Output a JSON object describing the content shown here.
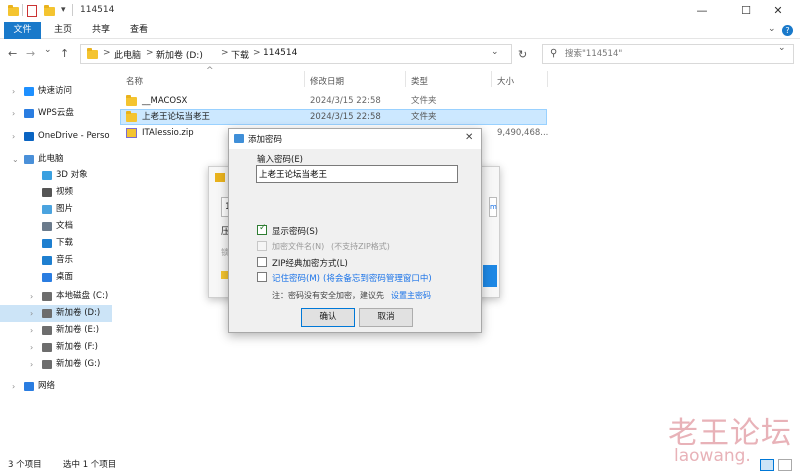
{
  "window": {
    "title": "114514",
    "minimize": "—",
    "maximize": "☐",
    "close": "✕"
  },
  "ribbon": {
    "tabs": [
      "文件",
      "主页",
      "共享",
      "查看"
    ],
    "collapse_icon": "chevron-down-icon",
    "help_icon": "help-icon"
  },
  "address": {
    "back": "←",
    "forward": "→",
    "recent": "⌄",
    "up": "↑",
    "crumbs": [
      "此电脑",
      "新加卷 (D:)",
      "下载",
      "114514"
    ],
    "separator": ">",
    "refresh": "↻",
    "search_placeholder": "搜索\"114514\""
  },
  "sidebar": {
    "items": [
      {
        "label": "快速访问",
        "icon": "star-icon",
        "color": "#1e90ff"
      },
      {
        "label": "WPS云盘",
        "icon": "cloud-icon",
        "color": "#2a7de1"
      },
      {
        "label": "OneDrive - Perso",
        "icon": "onedrive-icon",
        "color": "#0a64c2"
      },
      {
        "label": "此电脑",
        "icon": "computer-icon",
        "color": "#4a90d9"
      },
      {
        "label": "3D 对象",
        "icon": "cube-icon",
        "color": "#3aa0e0"
      },
      {
        "label": "视频",
        "icon": "video-icon",
        "color": "#555555"
      },
      {
        "label": "图片",
        "icon": "picture-icon",
        "color": "#4aa3df"
      },
      {
        "label": "文档",
        "icon": "document-icon",
        "color": "#6b7b8c"
      },
      {
        "label": "下载",
        "icon": "download-icon",
        "color": "#1e7fd0"
      },
      {
        "label": "音乐",
        "icon": "music-icon",
        "color": "#1e7fd0"
      },
      {
        "label": "桌面",
        "icon": "desktop-icon",
        "color": "#2a7de1"
      },
      {
        "label": "本地磁盘 (C:)",
        "icon": "drive-icon",
        "color": "#6d6d6d"
      },
      {
        "label": "新加卷 (D:)",
        "icon": "drive-icon",
        "color": "#6d6d6d"
      },
      {
        "label": "新加卷 (E:)",
        "icon": "drive-icon",
        "color": "#6d6d6d"
      },
      {
        "label": "新加卷 (F:)",
        "icon": "drive-icon",
        "color": "#6d6d6d"
      },
      {
        "label": "新加卷 (G:)",
        "icon": "drive-icon",
        "color": "#6d6d6d"
      },
      {
        "label": "网络",
        "icon": "network-icon",
        "color": "#2a7de1"
      }
    ]
  },
  "files": {
    "columns": [
      "名称",
      "修改日期",
      "类型",
      "大小"
    ],
    "rows": [
      {
        "name": "__MACOSX",
        "date": "2024/3/15 22:58",
        "type": "文件夹",
        "size": ""
      },
      {
        "name": "上老王论坛当老王",
        "date": "2024/3/15 22:58",
        "type": "文件夹",
        "size": ""
      },
      {
        "name": "ITAlessio.zip",
        "date": "",
        "type": "",
        "size": "9,490,468..."
      }
    ]
  },
  "status": {
    "count": "3 个项目",
    "selected": "选中 1 个项目"
  },
  "bg_dialog": {
    "field_value": "1",
    "label1": "压",
    "label2": "锁",
    "side_text": "m"
  },
  "password_dialog": {
    "title": "添加密码",
    "input_label": "输入密码(E)",
    "password_value": "上老王论坛当老王",
    "show_password": "显示密码(S)",
    "encrypt_filenames": "加密文件名(N)",
    "encrypt_filenames_note": "(不支持ZIP格式)",
    "zip_legacy": "ZIP经典加密方式(L)",
    "remember_password": "记住密码(M)",
    "remember_note": "(将会备忘到密码管理窗口中)",
    "note_prefix": "注：密码没有安全加密，建议先",
    "note_link": "设置主密码",
    "ok": "确认",
    "cancel": "取消"
  },
  "watermark": {
    "line1": "老王论坛",
    "line2": "laowang."
  }
}
